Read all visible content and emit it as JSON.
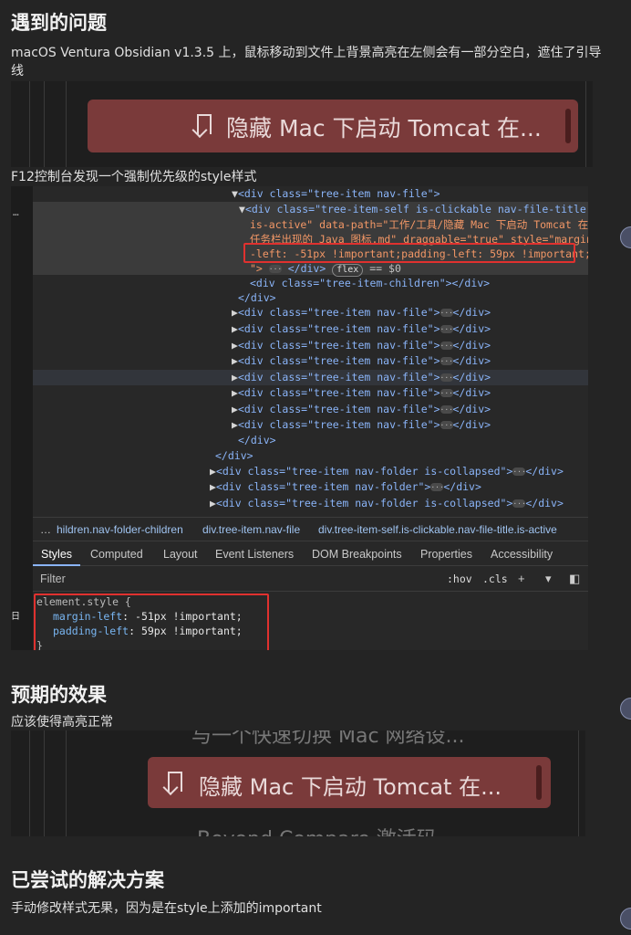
{
  "section1": {
    "heading": "遇到的问题",
    "desc": "macOS Ventura Obsidian v1.3.5 上，鼠标移动到文件上背景高亮在左侧会有一部分空白，遮住了引导",
    "desc_wrap": "线"
  },
  "shot1": {
    "file_title": "隐藏 Mac 下启动 Tomcat 在..."
  },
  "caption_f12": "F12控制台发现一个强制优先级的style样式",
  "devtools": {
    "more_dots": "…",
    "code_lines": {
      "l0": "<div class=\"tree-item nav-file\">",
      "l1": "<div class=\"tree-item-self is-clickable nav-file-title",
      "l2": "is-active\" data-path=\"工作/工具/隐藏 Mac 下启动 Tomcat 在",
      "l3": "任务栏出现的 Java 图标.md\" draggable=\"true\" style=\"margin",
      "l4": "-left: -51px !important;padding-left: 59px !important;",
      "l5_a": "\">",
      "l5_b": "</div>",
      "l5_flex": "flex",
      "l5_c": "== $0",
      "l6": "<div class=\"tree-item-children\"></div>",
      "l7": "</div>",
      "nav_file": "<div class=\"tree-item nav-file\">",
      "nav_file_end": "</div>",
      "l16": "</div>",
      "l17": "</div>",
      "folder_collapsed": "<div class=\"tree-item nav-folder is-collapsed\">",
      "folder": "<div class=\"tree-item nav-folder\">"
    },
    "breadcrumbs": [
      "…",
      "hildren.nav-folder-children",
      "div.tree-item.nav-file",
      "div.tree-item-self.is-clickable.nav-file-title.is-active"
    ],
    "tabs": [
      "Styles",
      "Computed",
      "Layout",
      "Event Listeners",
      "DOM Breakpoints",
      "Properties",
      "Accessibility"
    ],
    "filter_placeholder": "Filter",
    "hov": ":hov",
    "cls": ".cls",
    "plus": "+",
    "element_style": "element.style {",
    "prop1_name": "margin-left",
    "prop1_value": "-51px !important;",
    "prop2_name": "padding-left",
    "prop2_value": "59px !important;",
    "close_brace": "}",
    "side_char": "日"
  },
  "section2": {
    "heading": "预期的效果",
    "desc": "应该使得高亮正常"
  },
  "shot2": {
    "ghost_top": "与一个快速切换 Mac 网络设...",
    "file_title": "隐藏 Mac 下启动 Tomcat 在...",
    "ghost_bottom": "Beyond Compare 激活码"
  },
  "section3": {
    "heading": "已尝试的解决方案",
    "desc": "手动修改样式无果，因为是在style上添加的important"
  }
}
